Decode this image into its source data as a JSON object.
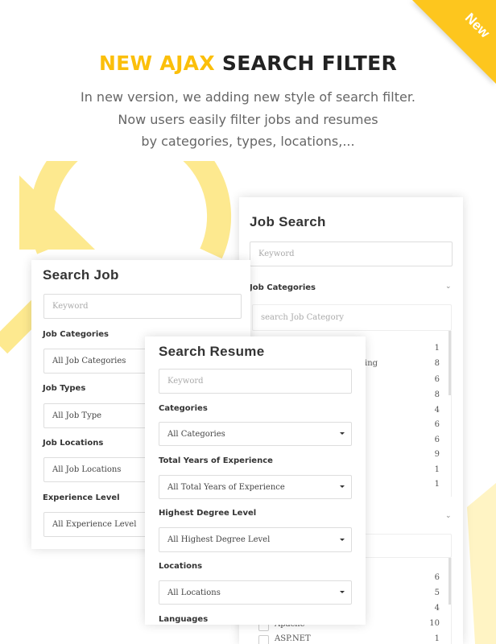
{
  "ribbon": {
    "label": "New",
    "color": "#fdc61e"
  },
  "header": {
    "title_highlight": "NEW AJAX",
    "title_rest": "SEARCH FILTER",
    "accent": "#fbbf0a",
    "subtitle_lines": [
      "In new version, we adding new style of search filter.",
      "Now users easily filter jobs and resumes",
      "by categories, types, locations,..."
    ]
  },
  "job_search_panel": {
    "title": "Job Search",
    "keyword_placeholder": "Keyword",
    "categories_label": "Job Categories",
    "category_search_placeholder": "search Job Category",
    "category_partial_text": "ing",
    "category_counts": [
      "1",
      "8",
      "6",
      "8",
      "4",
      "6",
      "6",
      "9",
      "1",
      "1"
    ],
    "second_list_counts": [
      "6",
      "5",
      "4",
      "10",
      "1"
    ],
    "second_list_items": [
      "Apache",
      "ASP.NET"
    ]
  },
  "search_job_panel": {
    "title": "Search Job",
    "keyword_placeholder": "Keyword",
    "fields": [
      {
        "label": "Job Categories",
        "value": "All Job Categories"
      },
      {
        "label": "Job Types",
        "value": "All Job Type"
      },
      {
        "label": "Job Locations",
        "value": "All Job Locations"
      },
      {
        "label": "Experience Level",
        "value": "All Experience Level"
      }
    ]
  },
  "search_resume_panel": {
    "title": "Search Resume",
    "keyword_placeholder": "Keyword",
    "fields": [
      {
        "label": "Categories",
        "value": "All Categories"
      },
      {
        "label": "Total Years of Experience",
        "value": "All Total Years of Experience"
      },
      {
        "label": "Highest Degree Level",
        "value": "All Highest Degree Level"
      },
      {
        "label": "Locations",
        "value": "All Locations"
      }
    ],
    "last_label": "Languages"
  }
}
